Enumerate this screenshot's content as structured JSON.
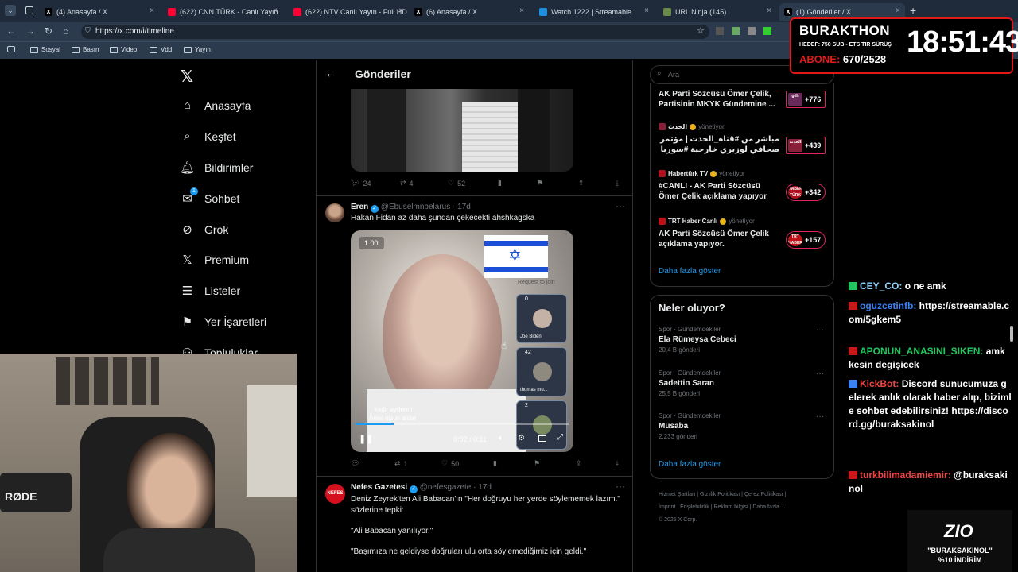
{
  "browser": {
    "tabs": [
      {
        "label": "(4) Anasayfa / X",
        "icon": "x-logo-icon",
        "color": "#000000"
      },
      {
        "label": "(622) CNN TÜRK - Canlı Yayın",
        "icon": "youtube-icon",
        "color": "#ff0033"
      },
      {
        "label": "(622) NTV Canlı Yayın - Full HD",
        "icon": "youtube-icon",
        "color": "#ff0033"
      },
      {
        "label": "(6) Anasayfa / X",
        "icon": "x-logo-icon",
        "color": "#000000"
      },
      {
        "label": "Watch 1222 | Streamable",
        "icon": "streamable-icon",
        "color": "#1f8fe0"
      },
      {
        "label": "URL Ninja (145)",
        "icon": "ninja-icon",
        "color": "#6a8a4a"
      },
      {
        "label": "(1) Gönderiler / X",
        "icon": "x-logo-icon",
        "color": "#000000"
      }
    ],
    "url": "https://x.com/i/timeline",
    "bookmarks": [
      "Sosyal",
      "Basın",
      "Video",
      "Vdd",
      "Yayın"
    ]
  },
  "nav": {
    "items": [
      {
        "label": "Anasayfa",
        "icon": "home-icon"
      },
      {
        "label": "Keşfet",
        "icon": "search-icon"
      },
      {
        "label": "Bildirimler",
        "icon": "bell-icon"
      },
      {
        "label": "Sohbet",
        "icon": "mail-icon",
        "badge": "1"
      },
      {
        "label": "Grok",
        "icon": "grok-icon"
      },
      {
        "label": "Premium",
        "icon": "x-logo-icon"
      },
      {
        "label": "Listeler",
        "icon": "list-icon"
      },
      {
        "label": "Yer İşaretleri",
        "icon": "bookmark-icon"
      },
      {
        "label": "Topluluklar",
        "icon": "people-icon"
      }
    ]
  },
  "main": {
    "header": "Gönderiler",
    "tweet1_actions": {
      "replies": "24",
      "retweets": "4",
      "likes": "52"
    },
    "tweet2": {
      "name": "Eren",
      "handle": "@Ebuselmnbelarus",
      "time": "17d",
      "text": "Hakan Fidan az daha şundan çekecekti ahshkagska",
      "video": {
        "speed": "1.00",
        "time": "0:02 / 0:11",
        "progress": 0.18,
        "request_label": "Request to join",
        "participants": [
          {
            "name": "Joe Biden",
            "count": "0"
          },
          {
            "name": "thomas mu...",
            "count": "42"
          },
          {
            "name": "",
            "count": "2"
          }
        ],
        "comment_user": "kadir aydemir",
        "comment_text": "helal olsun aidar"
      },
      "actions": {
        "replies": "",
        "retweets": "1",
        "likes": "50"
      }
    },
    "tweet3": {
      "name": "Nefes Gazetesi",
      "handle": "@nefesgazete",
      "time": "17d",
      "avatar": "NEFES",
      "text": "Deniz Zeyrek'ten Ali Babacan'ın \"Her doğruyu her yerde söylememek lazım.\" sözlerine tepki:",
      "quote1": "\"Ali Babacan yanılıyor.\"",
      "quote2": "\"Başımıza ne geldiyse doğruları ulu orta söylemediğimiz için geldi.\""
    }
  },
  "right": {
    "search_placeholder": "Ara",
    "live": [
      {
        "account": "",
        "title": "AK Parti Sözcüsü Ömer Çelik, Partisinin MKYK Gündemine ...",
        "count": "+776",
        "thumb": "gdh",
        "thumb_color": "#6a2a5a"
      },
      {
        "account": "الحدث",
        "status": "yönetiyor",
        "title": "مباشر من #قناة_الحدث | مؤتمر صحافي لوزيري خارجية #سوريا و ...",
        "count": "+439",
        "thumb": "الحدث",
        "thumb_color": "#8a1f3a"
      },
      {
        "account": "Habertürk TV",
        "status": "yönetiyor",
        "title": "#CANLI - AK Parti Sözcüsü Ömer Çelik açıklama yapıyor",
        "count": "+342",
        "thumb": "HABER TÜRK",
        "thumb_color": "#b01020"
      },
      {
        "account": "TRT Haber Canlı",
        "status": "yönetiyor",
        "title": "AK Parti Sözcüsü Ömer Çelik açıklama yapıyor.",
        "count": "+157",
        "thumb": "TRT HABER",
        "thumb_color": "#c01018"
      }
    ],
    "show_more": "Daha fazla göster",
    "trends_title": "Neler oluyor?",
    "trends": [
      {
        "category": "Spor · Gündemdekiler",
        "name": "Ela Rümeysa Cebeci",
        "posts": "20,4 B gönderi"
      },
      {
        "category": "Spor · Gündemdekiler",
        "name": "Sadettin Saran",
        "posts": "25,5 B gönderi"
      },
      {
        "category": "Spor · Gündemdekiler",
        "name": "Musaba",
        "posts": "2.233 gönderi"
      }
    ],
    "footer": [
      "Hizmet Şartları",
      "Gizlilik Politikası",
      "Çerez Politikası",
      "İmprint",
      "Erişilebilirlik",
      "Reklam bilgisi",
      "Daha fazla ...",
      "© 2025 X Corp."
    ]
  },
  "overlay": {
    "title": "BURAKTHON",
    "subtitle": "HEDEF: 750 SUB - ETS TIR SÜRÜŞ",
    "subs_label": "ABONE:",
    "subs": "670/2528",
    "clock": "18:51:43",
    "sponsor_code": "\"BURAKSAKINOL\"",
    "sponsor_discount": "%10 İNDİRİM",
    "sponsor_brand": "ZIO",
    "mic_brand": "RØDE"
  },
  "chat": [
    {
      "user": "CEY_CO:",
      "text": "o ne amk",
      "color": "#8fd3ff"
    },
    {
      "user": "oguzcetinfb:",
      "text": "https://streamable.com/5gkem5",
      "color": "#3b82f6"
    },
    {
      "user": "APONUN_ANASINI_SIKEN:",
      "text": "amk kesin degişicek",
      "color": "#22c55e"
    },
    {
      "user": "KickBot:",
      "text": "Discord sunucumuza gelerek anlık olarak haber alıp, bizimle sohbet edebilirsiniz! https://discord.gg/buraksakinol",
      "color": "#ef4444"
    },
    {
      "user": "turkbilimadamiemir:",
      "text": "@buraksakinol",
      "color": "#ef4444"
    }
  ]
}
